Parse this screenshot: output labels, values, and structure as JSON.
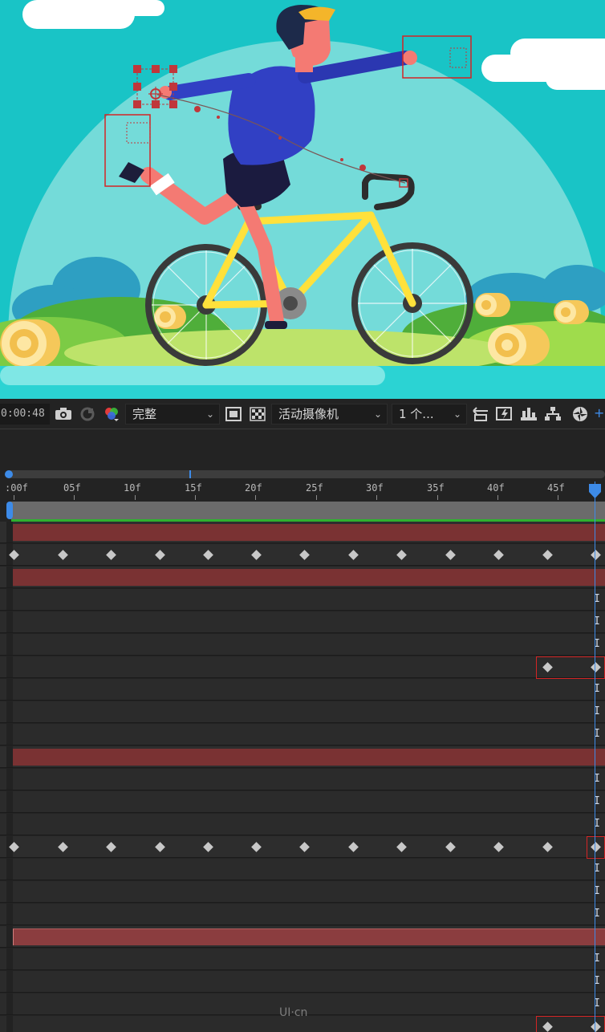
{
  "toolbar": {
    "timecode": "0:00:48",
    "resolution": "完整",
    "camera": "活动摄像机",
    "views": "1 个...",
    "icons": [
      "camera-icon",
      "snapshot-icon",
      "color-channel-icon",
      "region-icon",
      "transparency-grid-icon",
      "reset-exposure-icon",
      "fast-preview-icon",
      "timeline-icon",
      "flowchart-icon",
      "shutter-icon"
    ]
  },
  "timeline": {
    "ruler_labels": [
      ":00f",
      "05f",
      "10f",
      "15f",
      "20f",
      "25f",
      "30f",
      "35f",
      "40f",
      "45f"
    ],
    "hold_glyph": "I"
  },
  "watermark": "UI·cn",
  "colors": {
    "sky": "#19c4c6",
    "accent": "#3d8be8",
    "layer_bar": "#7a3233",
    "highlight": "#d32525",
    "keyframe": "#c8c8c8"
  }
}
